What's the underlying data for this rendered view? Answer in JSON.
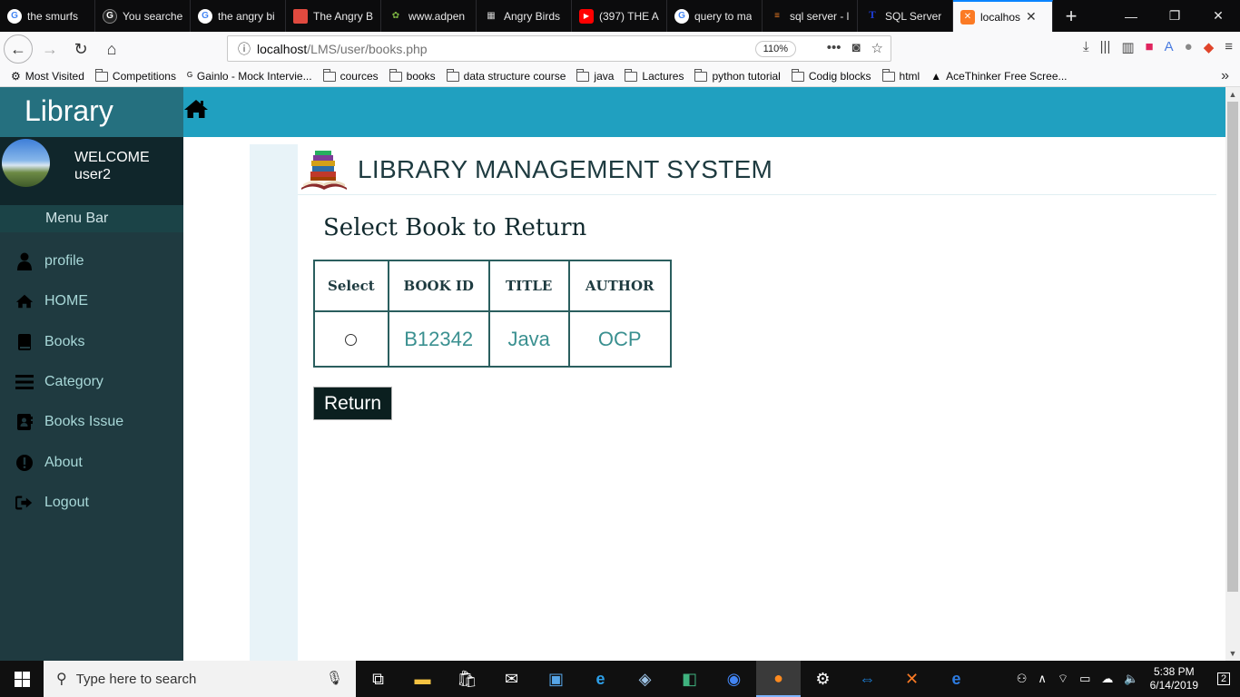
{
  "browser": {
    "tabs": [
      {
        "label": "the smurfs",
        "icon": "google-icon",
        "color": "#4285f4"
      },
      {
        "label": "You searche",
        "icon": "genius-icon",
        "color": "#ffffff"
      },
      {
        "label": "the angry bi",
        "icon": "google-icon",
        "color": "#4285f4"
      },
      {
        "label": "The Angry B",
        "icon": "slides-icon",
        "color": "#e04a3f"
      },
      {
        "label": "www.adpen",
        "icon": "puzzle-icon",
        "color": "#7cb342"
      },
      {
        "label": "Angry Birds",
        "icon": "clapper-icon",
        "color": "#cccccc"
      },
      {
        "label": "(397) THE A",
        "icon": "youtube-icon",
        "color": "#ff0000"
      },
      {
        "label": "query to ma",
        "icon": "google-icon",
        "color": "#4285f4"
      },
      {
        "label": "sql server - l",
        "icon": "stackoverflow-icon",
        "color": "#f48024"
      },
      {
        "label": "SQL Server",
        "icon": "t-icon",
        "color": "#1e3cd2"
      },
      {
        "label": "localhos",
        "icon": "xampp-icon",
        "color": "#fb7a24"
      }
    ],
    "url_host": "localhost",
    "url_path": "/LMS/user/books.php",
    "zoom": "110%",
    "bookmarks": [
      {
        "label": "Most Visited",
        "icon": "gear-icon"
      },
      {
        "label": "Competitions",
        "icon": "folder-icon"
      },
      {
        "label": "Gainlo - Mock Intervie...",
        "icon": "gainlo-icon"
      },
      {
        "label": "cources",
        "icon": "folder-icon"
      },
      {
        "label": "books",
        "icon": "folder-icon"
      },
      {
        "label": "data structure course",
        "icon": "folder-icon"
      },
      {
        "label": "java",
        "icon": "folder-icon"
      },
      {
        "label": "Lactures",
        "icon": "folder-icon"
      },
      {
        "label": "python tutorial",
        "icon": "folder-icon"
      },
      {
        "label": "Codig blocks",
        "icon": "folder-icon"
      },
      {
        "label": "html",
        "icon": "folder-icon"
      },
      {
        "label": "AceThinker Free Scree...",
        "icon": "acethinker-icon"
      }
    ]
  },
  "sidebar": {
    "brand": "Library",
    "welcome": "WELCOME",
    "username": "user2",
    "menu_title": "Menu Bar",
    "items": [
      {
        "label": "profile",
        "icon": "user-icon"
      },
      {
        "label": "HOME",
        "icon": "home-icon"
      },
      {
        "label": "Books",
        "icon": "book-icon"
      },
      {
        "label": "Category",
        "icon": "bars-icon"
      },
      {
        "label": "Books Issue",
        "icon": "address-book-icon"
      },
      {
        "label": "About",
        "icon": "info-icon"
      },
      {
        "label": "Logout",
        "icon": "logout-icon"
      }
    ]
  },
  "main": {
    "system_title": "LIBRARY MANAGEMENT SYSTEM",
    "subtitle": "Select Book to Return",
    "table": {
      "headers": [
        "Select",
        "BOOK ID",
        "TITLE",
        "AUTHOR"
      ],
      "rows": [
        {
          "book_id": "B12342",
          "title": "Java",
          "author": "OCP",
          "selected": false
        }
      ]
    },
    "return_label": "Return"
  },
  "taskbar": {
    "search_placeholder": "Type here to search",
    "time": "5:38 PM",
    "date": "6/14/2019",
    "notifications": "2"
  },
  "colors": {
    "sidebar_bg": "#1f3a40",
    "brand_bg": "#25707f",
    "topbar_bg": "#20a0c0",
    "menu_text": "#a8d8d8",
    "table_text": "#3a9090"
  }
}
